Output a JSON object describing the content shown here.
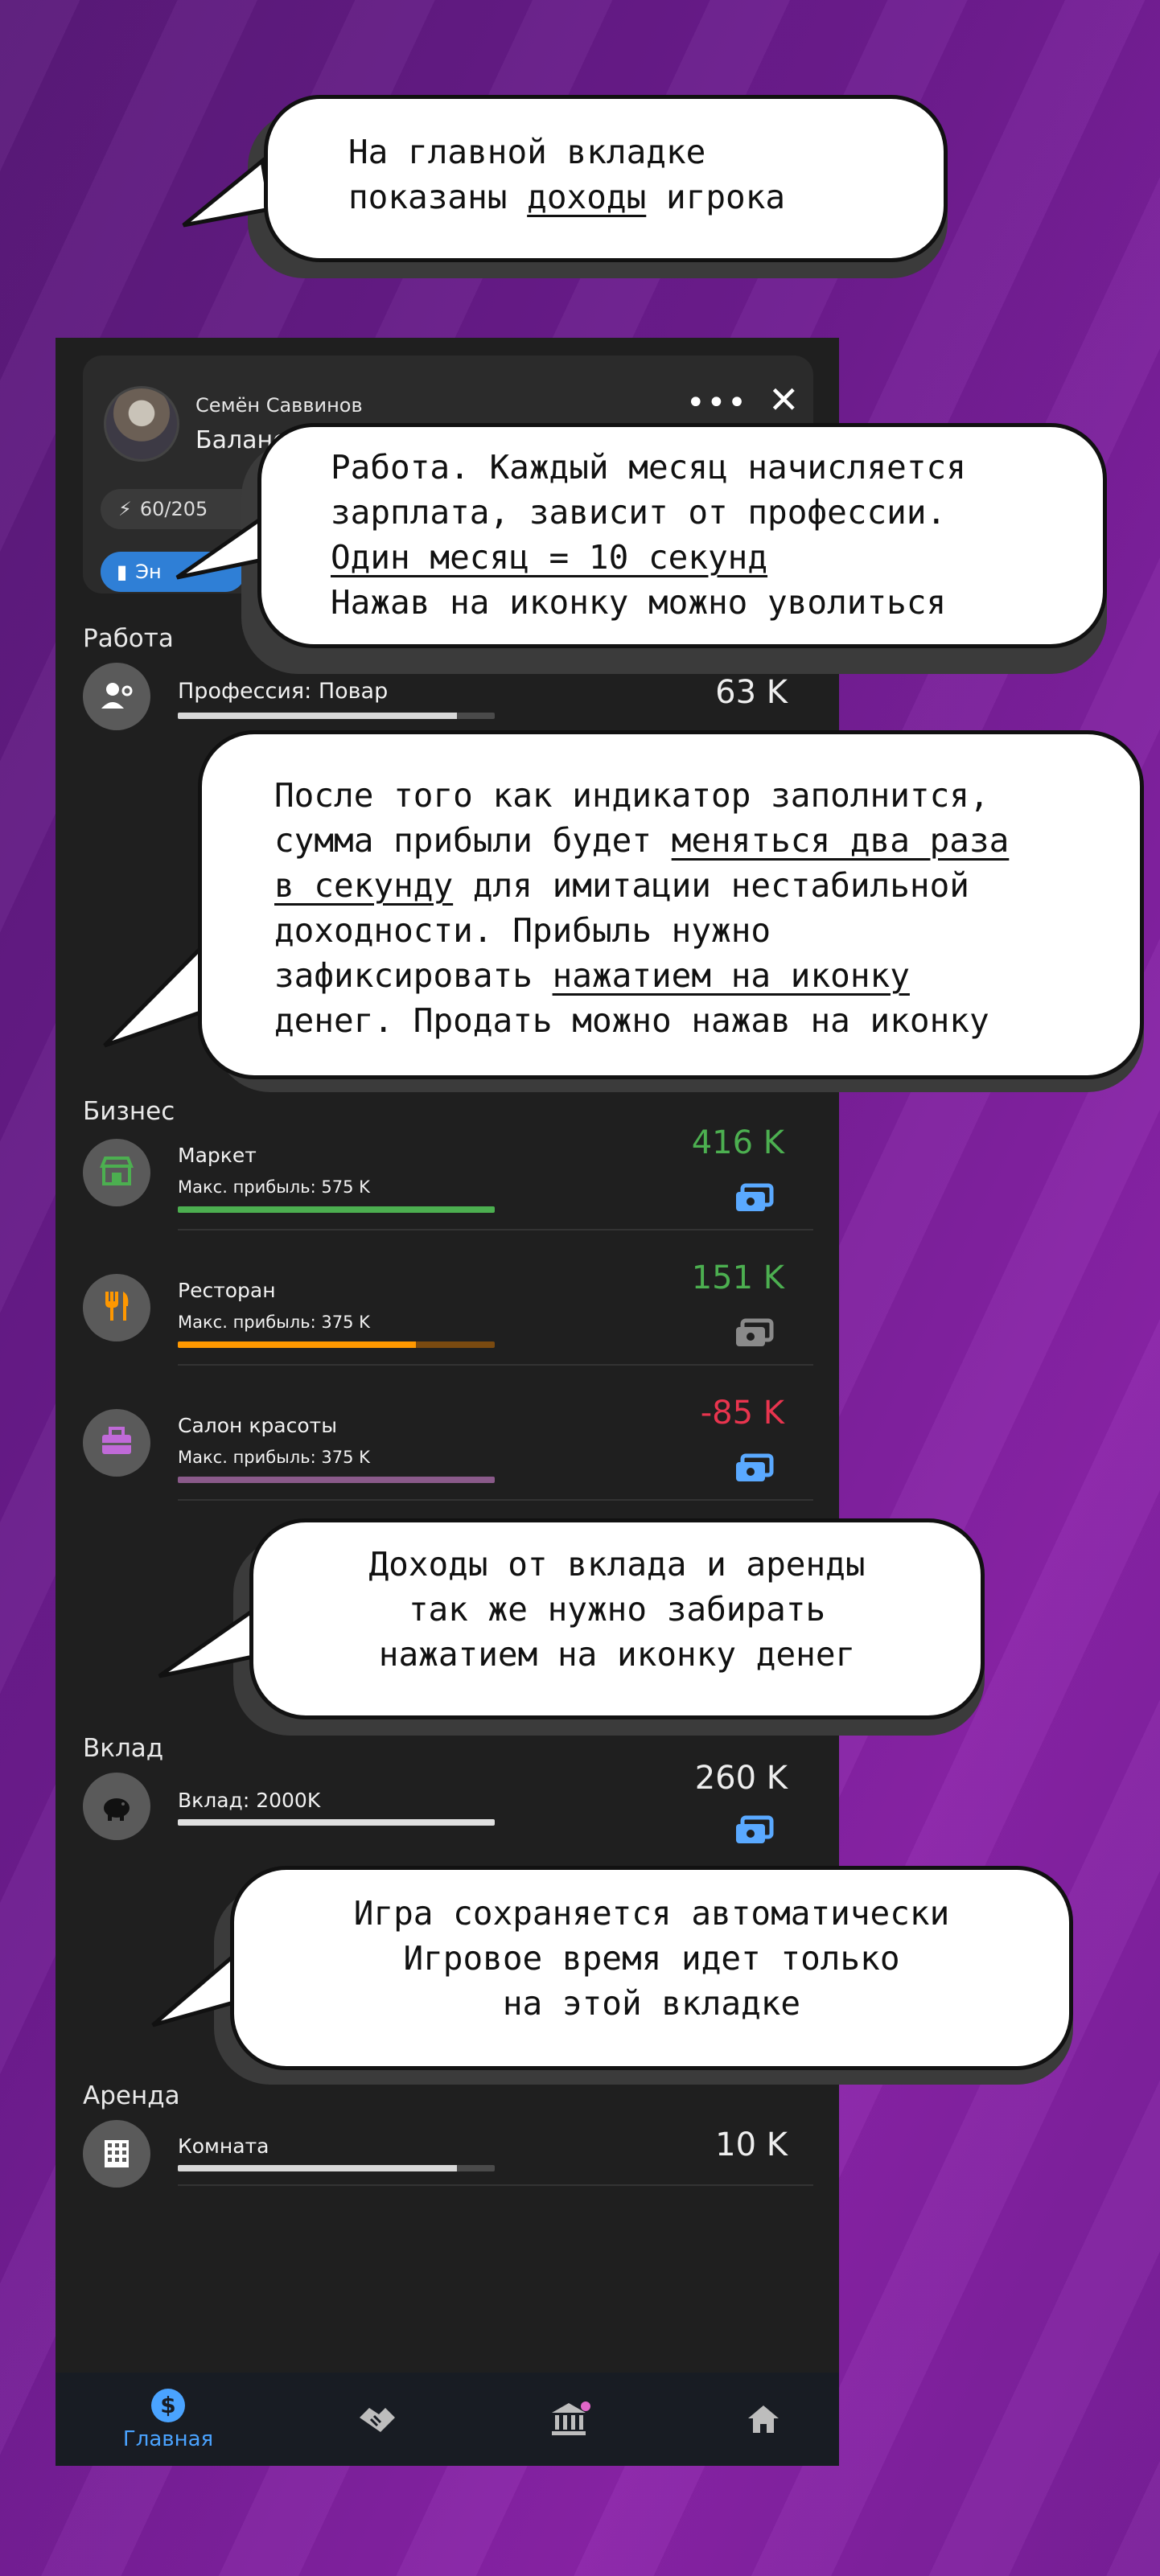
{
  "player": {
    "name": "Семён Саввинов",
    "balance_label": "Баланс: 2",
    "energy": "60/205",
    "chip_label": "Эн"
  },
  "work": {
    "title": "Работа",
    "profession": "Профессия: Повар",
    "amount": "63 K",
    "progress": 0.88
  },
  "business": {
    "title": "Бизнес",
    "items": [
      {
        "name": "Маркет",
        "max": "Макс. прибыль: 575 K",
        "amount": "416 K",
        "amount_color": "#4caf50",
        "bar_color": "#4caf50",
        "bar_bg": "#4caf50",
        "progress": 1.0,
        "icon": "store-icon",
        "icon_color": "#4caf50",
        "cash_active": true
      },
      {
        "name": "Ресторан",
        "max": "Макс. прибыль: 375 K",
        "amount": "151 K",
        "amount_color": "#4caf50",
        "bar_color": "#ff9800",
        "bar_bg": "#7a4a10",
        "progress": 0.75,
        "icon": "fork-knife-icon",
        "icon_color": "#ff9800",
        "cash_active": false
      },
      {
        "name": "Салон красоты",
        "max": "Макс. прибыль: 375 K",
        "amount": "-85 K",
        "amount_color": "#e8344e",
        "bar_color": "#8a5a8a",
        "bar_bg": "#8a5a8a",
        "progress": 1.0,
        "icon": "toolbox-icon",
        "icon_color": "#c06ad8",
        "cash_active": true
      }
    ]
  },
  "deposit": {
    "title": "Вклад",
    "name": "Вклад: 2000K",
    "amount": "260 K"
  },
  "rent": {
    "title": "Аренда",
    "name": "Комната",
    "amount": "10 K",
    "progress": 0.88
  },
  "nav": {
    "home_label": "Главная",
    "items": [
      "dollar-icon",
      "handshake-icon",
      "bank-icon",
      "house-icon"
    ]
  },
  "bubbles": {
    "b1": [
      "На главной вкладке",
      "показаны ",
      "доходы",
      " игрока"
    ],
    "b2": [
      "Работа. Каждый месяц начисляется",
      "зарплата, зависит от профессии.",
      "Один месяц = 10 секунд",
      "Нажав на иконку можно уволиться"
    ],
    "b3": [
      "После того как индикатор заполнится,",
      "сумма прибыли будет ",
      "меняться два раза",
      "в секунду",
      " для имитации нестабильной",
      "доходности. Прибыль нужно",
      "зафиксировать ",
      "нажатием на иконку",
      "денег. Продать можно нажав на иконку"
    ],
    "b4": [
      "Доходы от вклада и аренды",
      "так же нужно забирать",
      "нажатием на иконку денег"
    ],
    "b5": [
      "Игра сохраняется автоматически",
      "Игровое время идет только",
      "на этой вкладке"
    ]
  },
  "colors": {
    "accent_blue": "#4aa3ff",
    "cash_active": "#5aa9ff",
    "cash_inactive": "#8a8a8a"
  }
}
